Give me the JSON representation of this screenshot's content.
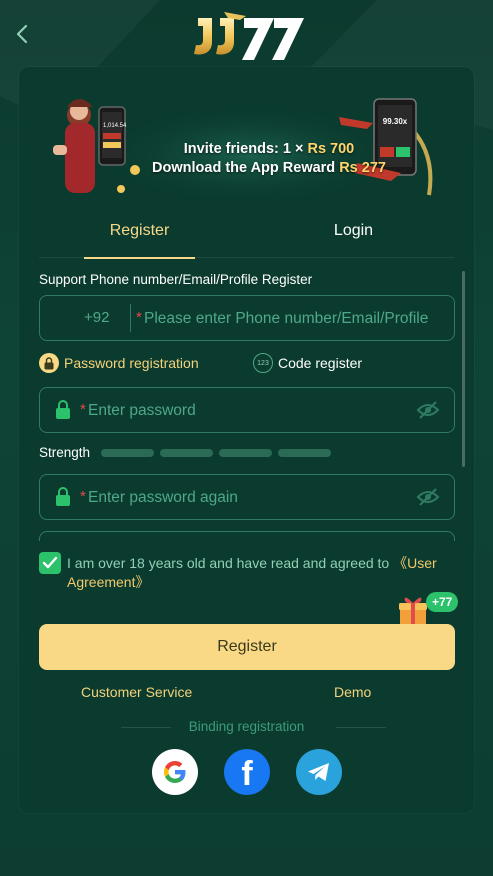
{
  "header": {
    "back_icon": "chevron-left-icon",
    "logo_text": "JJ77"
  },
  "banner": {
    "line1_prefix": "Invite friends: 1 × ",
    "line1_amount": "Rs 700",
    "line2_prefix": "Download the App Reward ",
    "line2_amount": "Rs 277",
    "phone_left_value": "1,014.54",
    "phone_right_value": "99.30x"
  },
  "tabs": {
    "register": "Register",
    "login": "Login"
  },
  "form": {
    "account_label": "Support Phone number/Email/Profile Register",
    "country_code": "+92",
    "account_placeholder": "Please enter Phone number/Email/Profile",
    "mode_password": "Password registration",
    "mode_code_icon_text": "123",
    "mode_code": "Code register",
    "password_placeholder": "Enter password",
    "strength_label": "Strength",
    "confirm_placeholder": "Enter password again",
    "required_mark": "*"
  },
  "agreement": {
    "text": "I am over 18 years old and have read and agreed to ",
    "link": "《User Agreement》",
    "checked": true
  },
  "gift": {
    "badge": "+77"
  },
  "actions": {
    "register_button": "Register",
    "customer_service": "Customer Service",
    "demo": "Demo"
  },
  "binding": {
    "label": "Binding registration",
    "providers": [
      "google",
      "facebook",
      "telegram"
    ],
    "facebook_glyph": "f"
  },
  "colors": {
    "background": "#0c3a2e",
    "card": "#0b3b2f",
    "accent_gold": "#f9d886",
    "field_border": "#2f7a62",
    "placeholder": "#4fa889",
    "checkbox": "#2cc26b"
  }
}
